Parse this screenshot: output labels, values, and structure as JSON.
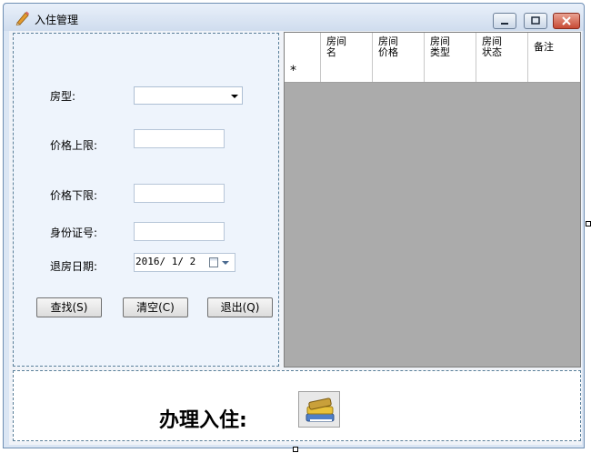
{
  "window": {
    "title": "入住管理"
  },
  "form": {
    "room_type_label": "房型:",
    "room_type_value": "",
    "price_max_label": "价格上限:",
    "price_max_value": "",
    "price_min_label": "价格下限:",
    "price_min_value": "",
    "id_label": "身份证号:",
    "id_value": "",
    "checkout_label": "退房日期:",
    "checkout_value": "2016/ 1/ 2"
  },
  "buttons": {
    "search": "查找(S)",
    "clear": "清空(C)",
    "exit": "退出(Q)"
  },
  "grid": {
    "columns": [
      {
        "line1": "房间",
        "line2": "名"
      },
      {
        "line1": "房间",
        "line2": "价格"
      },
      {
        "line1": "房间",
        "line2": "类型"
      },
      {
        "line1": "房间",
        "line2": "状态"
      },
      {
        "line1": "备注",
        "line2": ""
      }
    ],
    "new_row_marker": "*"
  },
  "checkin": {
    "label": "办理入住:"
  },
  "icons": {
    "app": "pencil-icon",
    "checkin": "books-icon"
  }
}
